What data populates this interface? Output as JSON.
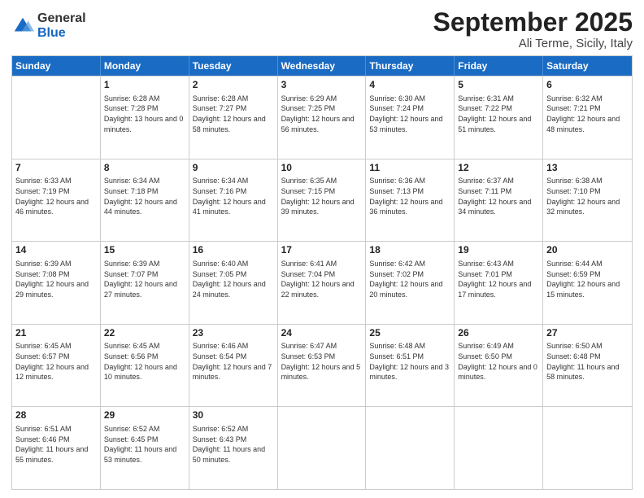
{
  "logo": {
    "general": "General",
    "blue": "Blue"
  },
  "title": "September 2025",
  "location": "Ali Terme, Sicily, Italy",
  "days_of_week": [
    "Sunday",
    "Monday",
    "Tuesday",
    "Wednesday",
    "Thursday",
    "Friday",
    "Saturday"
  ],
  "weeks": [
    [
      {
        "day": "",
        "sunrise": "",
        "sunset": "",
        "daylight": ""
      },
      {
        "day": "1",
        "sunrise": "Sunrise: 6:28 AM",
        "sunset": "Sunset: 7:28 PM",
        "daylight": "Daylight: 13 hours and 0 minutes."
      },
      {
        "day": "2",
        "sunrise": "Sunrise: 6:28 AM",
        "sunset": "Sunset: 7:27 PM",
        "daylight": "Daylight: 12 hours and 58 minutes."
      },
      {
        "day": "3",
        "sunrise": "Sunrise: 6:29 AM",
        "sunset": "Sunset: 7:25 PM",
        "daylight": "Daylight: 12 hours and 56 minutes."
      },
      {
        "day": "4",
        "sunrise": "Sunrise: 6:30 AM",
        "sunset": "Sunset: 7:24 PM",
        "daylight": "Daylight: 12 hours and 53 minutes."
      },
      {
        "day": "5",
        "sunrise": "Sunrise: 6:31 AM",
        "sunset": "Sunset: 7:22 PM",
        "daylight": "Daylight: 12 hours and 51 minutes."
      },
      {
        "day": "6",
        "sunrise": "Sunrise: 6:32 AM",
        "sunset": "Sunset: 7:21 PM",
        "daylight": "Daylight: 12 hours and 48 minutes."
      }
    ],
    [
      {
        "day": "7",
        "sunrise": "Sunrise: 6:33 AM",
        "sunset": "Sunset: 7:19 PM",
        "daylight": "Daylight: 12 hours and 46 minutes."
      },
      {
        "day": "8",
        "sunrise": "Sunrise: 6:34 AM",
        "sunset": "Sunset: 7:18 PM",
        "daylight": "Daylight: 12 hours and 44 minutes."
      },
      {
        "day": "9",
        "sunrise": "Sunrise: 6:34 AM",
        "sunset": "Sunset: 7:16 PM",
        "daylight": "Daylight: 12 hours and 41 minutes."
      },
      {
        "day": "10",
        "sunrise": "Sunrise: 6:35 AM",
        "sunset": "Sunset: 7:15 PM",
        "daylight": "Daylight: 12 hours and 39 minutes."
      },
      {
        "day": "11",
        "sunrise": "Sunrise: 6:36 AM",
        "sunset": "Sunset: 7:13 PM",
        "daylight": "Daylight: 12 hours and 36 minutes."
      },
      {
        "day": "12",
        "sunrise": "Sunrise: 6:37 AM",
        "sunset": "Sunset: 7:11 PM",
        "daylight": "Daylight: 12 hours and 34 minutes."
      },
      {
        "day": "13",
        "sunrise": "Sunrise: 6:38 AM",
        "sunset": "Sunset: 7:10 PM",
        "daylight": "Daylight: 12 hours and 32 minutes."
      }
    ],
    [
      {
        "day": "14",
        "sunrise": "Sunrise: 6:39 AM",
        "sunset": "Sunset: 7:08 PM",
        "daylight": "Daylight: 12 hours and 29 minutes."
      },
      {
        "day": "15",
        "sunrise": "Sunrise: 6:39 AM",
        "sunset": "Sunset: 7:07 PM",
        "daylight": "Daylight: 12 hours and 27 minutes."
      },
      {
        "day": "16",
        "sunrise": "Sunrise: 6:40 AM",
        "sunset": "Sunset: 7:05 PM",
        "daylight": "Daylight: 12 hours and 24 minutes."
      },
      {
        "day": "17",
        "sunrise": "Sunrise: 6:41 AM",
        "sunset": "Sunset: 7:04 PM",
        "daylight": "Daylight: 12 hours and 22 minutes."
      },
      {
        "day": "18",
        "sunrise": "Sunrise: 6:42 AM",
        "sunset": "Sunset: 7:02 PM",
        "daylight": "Daylight: 12 hours and 20 minutes."
      },
      {
        "day": "19",
        "sunrise": "Sunrise: 6:43 AM",
        "sunset": "Sunset: 7:01 PM",
        "daylight": "Daylight: 12 hours and 17 minutes."
      },
      {
        "day": "20",
        "sunrise": "Sunrise: 6:44 AM",
        "sunset": "Sunset: 6:59 PM",
        "daylight": "Daylight: 12 hours and 15 minutes."
      }
    ],
    [
      {
        "day": "21",
        "sunrise": "Sunrise: 6:45 AM",
        "sunset": "Sunset: 6:57 PM",
        "daylight": "Daylight: 12 hours and 12 minutes."
      },
      {
        "day": "22",
        "sunrise": "Sunrise: 6:45 AM",
        "sunset": "Sunset: 6:56 PM",
        "daylight": "Daylight: 12 hours and 10 minutes."
      },
      {
        "day": "23",
        "sunrise": "Sunrise: 6:46 AM",
        "sunset": "Sunset: 6:54 PM",
        "daylight": "Daylight: 12 hours and 7 minutes."
      },
      {
        "day": "24",
        "sunrise": "Sunrise: 6:47 AM",
        "sunset": "Sunset: 6:53 PM",
        "daylight": "Daylight: 12 hours and 5 minutes."
      },
      {
        "day": "25",
        "sunrise": "Sunrise: 6:48 AM",
        "sunset": "Sunset: 6:51 PM",
        "daylight": "Daylight: 12 hours and 3 minutes."
      },
      {
        "day": "26",
        "sunrise": "Sunrise: 6:49 AM",
        "sunset": "Sunset: 6:50 PM",
        "daylight": "Daylight: 12 hours and 0 minutes."
      },
      {
        "day": "27",
        "sunrise": "Sunrise: 6:50 AM",
        "sunset": "Sunset: 6:48 PM",
        "daylight": "Daylight: 11 hours and 58 minutes."
      }
    ],
    [
      {
        "day": "28",
        "sunrise": "Sunrise: 6:51 AM",
        "sunset": "Sunset: 6:46 PM",
        "daylight": "Daylight: 11 hours and 55 minutes."
      },
      {
        "day": "29",
        "sunrise": "Sunrise: 6:52 AM",
        "sunset": "Sunset: 6:45 PM",
        "daylight": "Daylight: 11 hours and 53 minutes."
      },
      {
        "day": "30",
        "sunrise": "Sunrise: 6:52 AM",
        "sunset": "Sunset: 6:43 PM",
        "daylight": "Daylight: 11 hours and 50 minutes."
      },
      {
        "day": "",
        "sunrise": "",
        "sunset": "",
        "daylight": ""
      },
      {
        "day": "",
        "sunrise": "",
        "sunset": "",
        "daylight": ""
      },
      {
        "day": "",
        "sunrise": "",
        "sunset": "",
        "daylight": ""
      },
      {
        "day": "",
        "sunrise": "",
        "sunset": "",
        "daylight": ""
      }
    ]
  ]
}
